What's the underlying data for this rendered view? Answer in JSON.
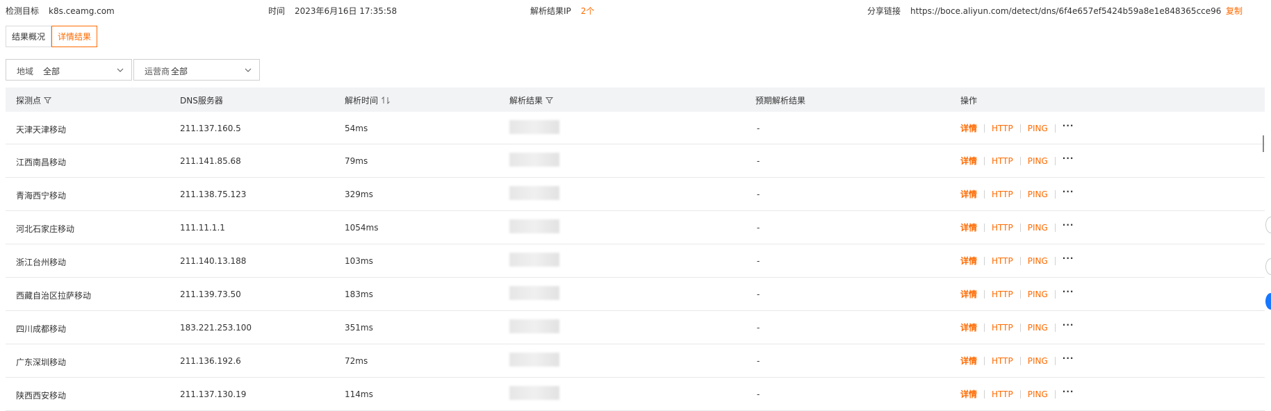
{
  "info": {
    "target_label": "检测目标",
    "target_value": "k8s.ceamg.com",
    "time_label": "时间",
    "time_value": "2023年6月16日 17:35:58",
    "ip_label": "解析结果IP",
    "ip_count": "2个",
    "share_label": "分享链接",
    "share_url": "https://boce.aliyun.com/detect/dns/6f4e657ef5424b59a8e1e848365cce96",
    "copy_label": "复制"
  },
  "tabs": [
    {
      "label": "结果概况"
    },
    {
      "label": "详情结果"
    }
  ],
  "filters": {
    "region_label": "地域",
    "region_value": "全部",
    "isp_label": "运营商",
    "isp_value": "全部"
  },
  "table": {
    "headers": [
      "探测点",
      "DNS服务器",
      "解析时间",
      "解析结果",
      "预期解析结果",
      "操作"
    ],
    "rows": [
      {
        "probe": "天津天津移动",
        "dns": "211.137.160.5",
        "time": "54ms",
        "expected": "-"
      },
      {
        "probe": "江西南昌移动",
        "dns": "211.141.85.68",
        "time": "79ms",
        "expected": "-"
      },
      {
        "probe": "青海西宁移动",
        "dns": "211.138.75.123",
        "time": "329ms",
        "expected": "-"
      },
      {
        "probe": "河北石家庄移动",
        "dns": "111.11.1.1",
        "time": "1054ms",
        "expected": "-"
      },
      {
        "probe": "浙江台州移动",
        "dns": "211.140.13.188",
        "time": "103ms",
        "expected": "-"
      },
      {
        "probe": "西藏自治区拉萨移动",
        "dns": "211.139.73.50",
        "time": "183ms",
        "expected": "-"
      },
      {
        "probe": "四川成都移动",
        "dns": "183.221.253.100",
        "time": "351ms",
        "expected": "-"
      },
      {
        "probe": "广东深圳移动",
        "dns": "211.136.192.6",
        "time": "72ms",
        "expected": "-"
      },
      {
        "probe": "陕西西安移动",
        "dns": "211.137.130.19",
        "time": "114ms",
        "expected": "-"
      }
    ],
    "actions": {
      "detail": "详情",
      "http": "HTTP",
      "ping": "PING",
      "more": "···"
    }
  },
  "colors": {
    "accent": "#ff6a00",
    "header_bg": "#f2f3f5",
    "border": "#e8e8e8"
  }
}
